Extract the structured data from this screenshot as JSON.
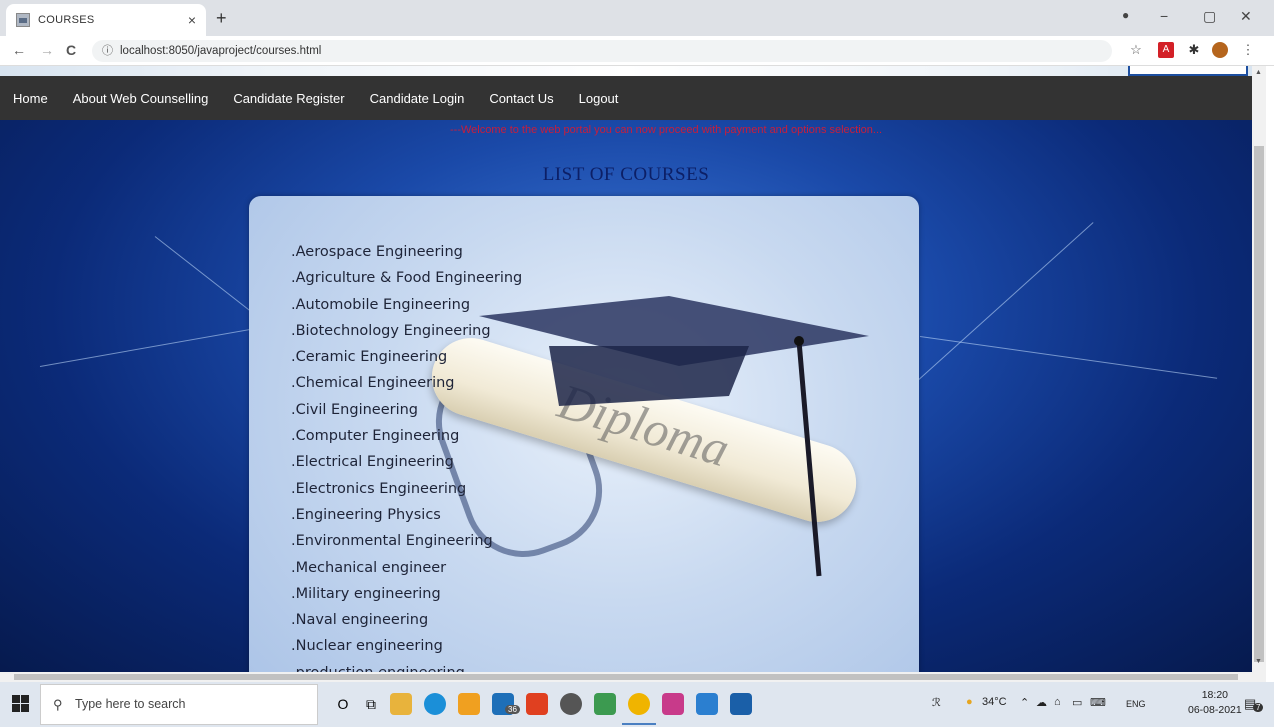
{
  "browser": {
    "tab_title": "COURSES",
    "tab_close": "×",
    "new_tab": "+",
    "url": "localhost:8050/javaproject/courses.html",
    "back": "←",
    "forward": "→",
    "reload": "C",
    "info": "ⓘ",
    "star": "☆",
    "minimize": "−",
    "maximize": "▢",
    "close": "✕",
    "menu": "⋮",
    "puzzle": "✱"
  },
  "nav": {
    "items": [
      "Home",
      "About Web Counselling",
      "Candidate Register",
      "Candidate Login",
      "Contact Us",
      "Logout"
    ]
  },
  "marquee": "---Welcome to the web portal you can now proceed with payment and options selection...",
  "page_title": "LIST OF COURSES",
  "scroll_text": "Diploma",
  "courses": [
    ".Aerospace Engineering",
    ".Agriculture & Food Engineering",
    ".Automobile Engineering",
    ".Biotechnology Engineering",
    ".Ceramic Engineering",
    ".Chemical Engineering",
    ".Civil Engineering",
    ".Computer Engineering",
    ".Electrical Engineering",
    ".Electronics Engineering",
    ".Engineering Physics",
    ".Environmental Engineering",
    ".Mechanical engineer",
    ".Military engineering",
    ".Naval engineering",
    ".Nuclear engineering",
    ".production engineering"
  ],
  "taskbar": {
    "search_placeholder": "Type here to search",
    "mail_badge": "36",
    "temperature": "34°C",
    "language": "ENG",
    "time": "18:20",
    "date": "06-08-2021",
    "notifications": "7"
  },
  "colors": {
    "navbar": "#333333",
    "title": "#0c1f66",
    "marquee": "#c81e3c"
  }
}
